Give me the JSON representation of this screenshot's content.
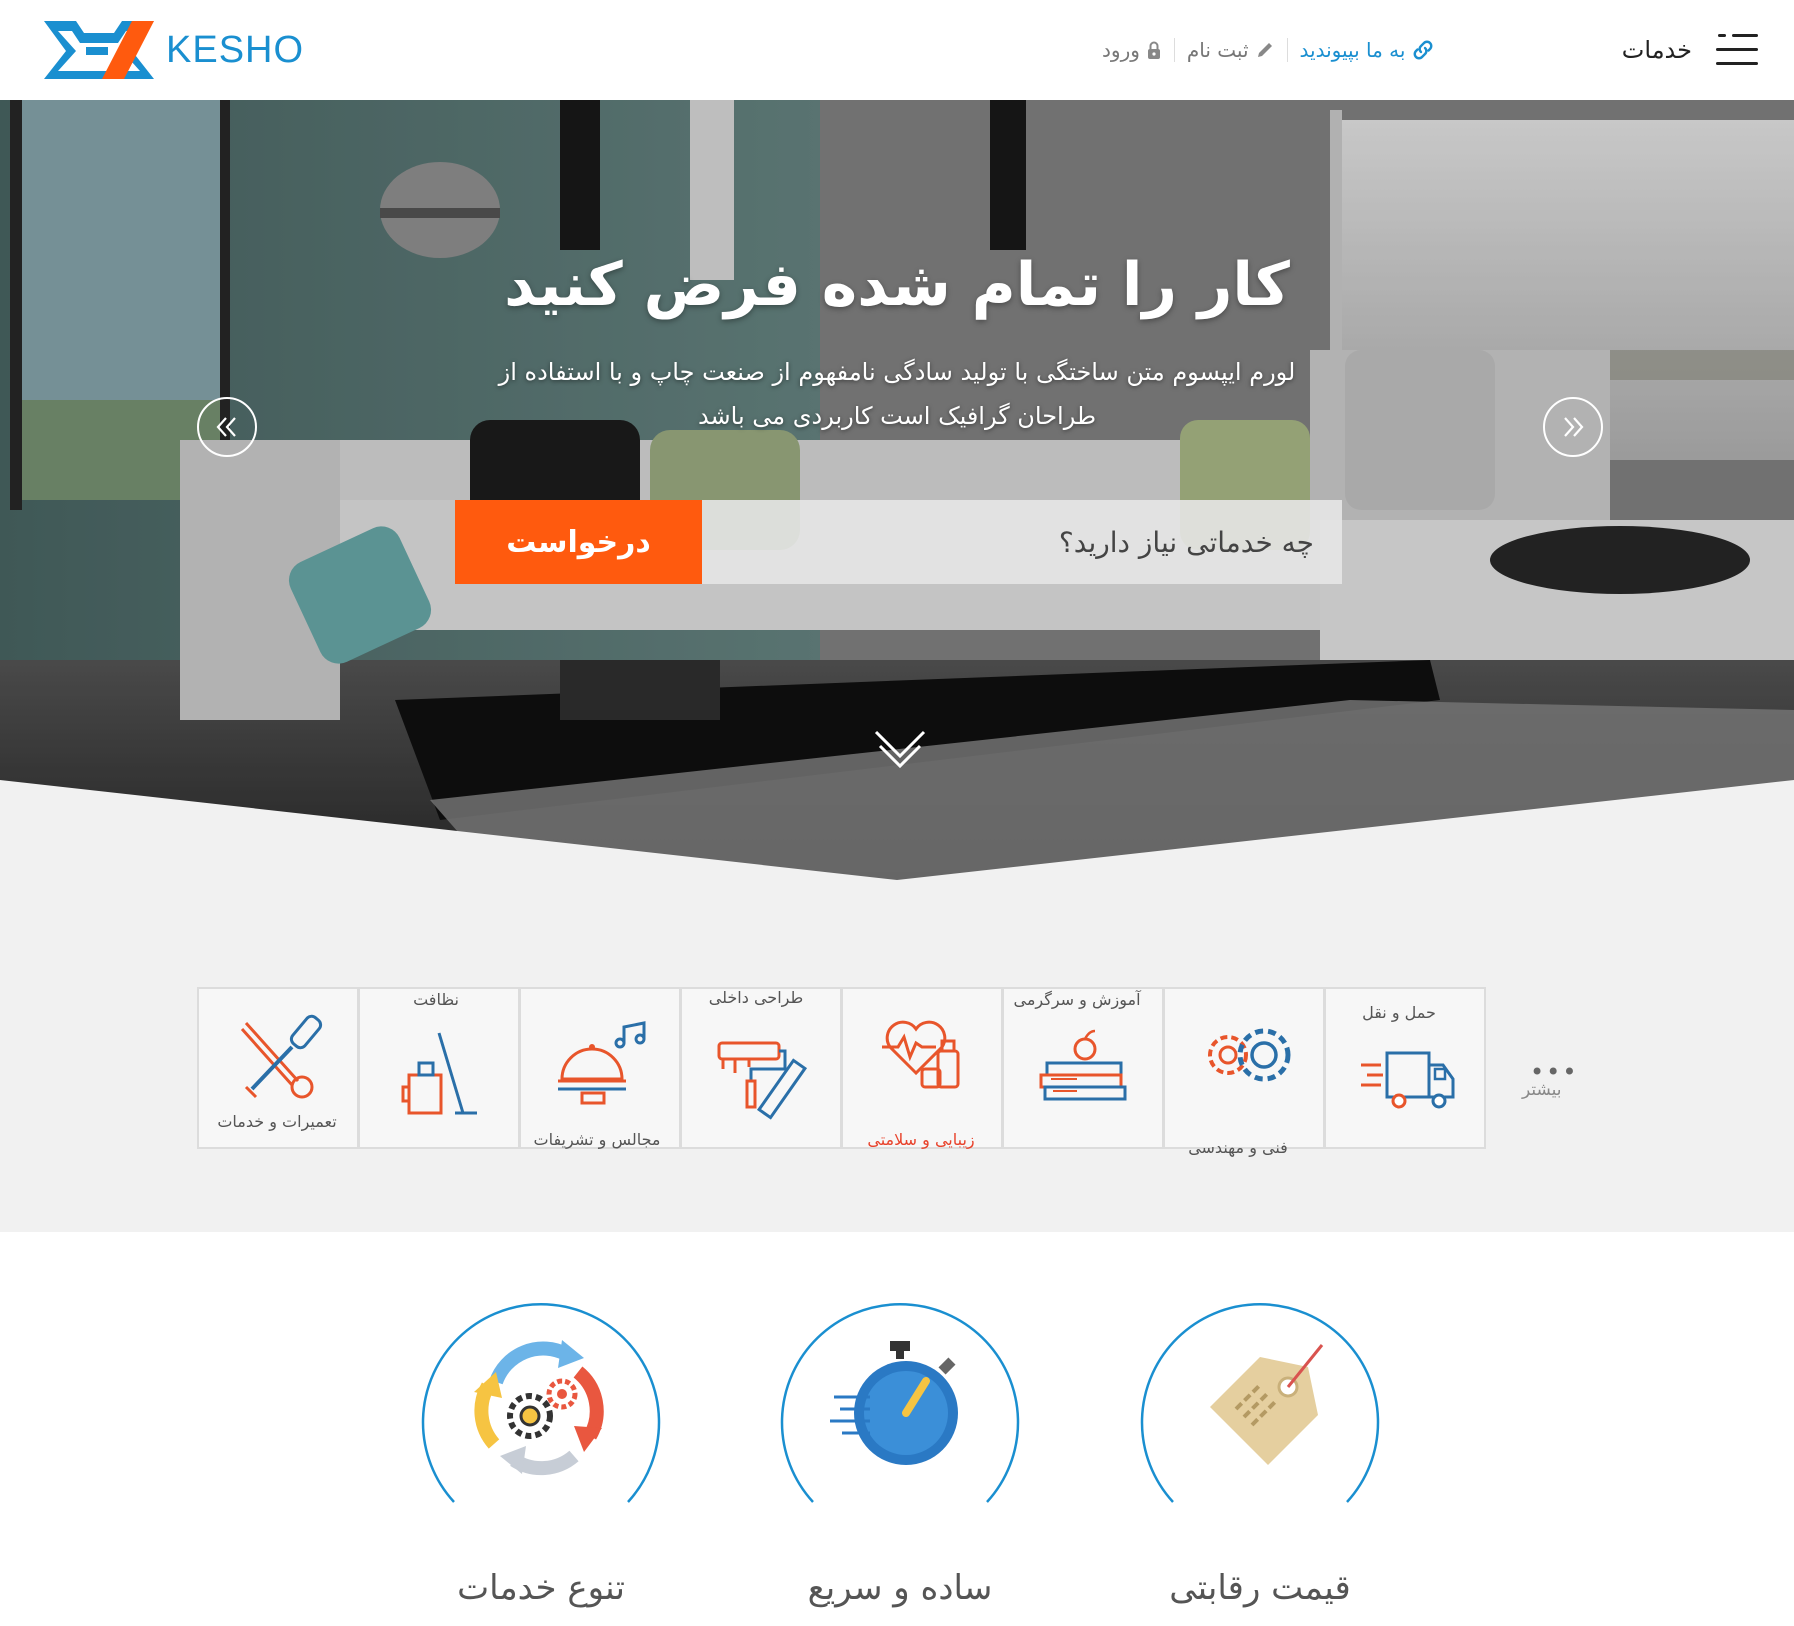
{
  "header": {
    "logo_text": "KESHO",
    "nav": {
      "join_label": "به ما بپیوندید",
      "signup_label": "ثبت نام",
      "login_label": "ورود"
    },
    "services_label": "خدمات"
  },
  "hero": {
    "title": "کار را تمام شده فرض کنید",
    "subtitle": "لورم ایپسوم متن ساختگی با تولید سادگی نامفهوم از صنعت چاپ و با استفاده از طراحان گرافیک است کاربردی می باشد",
    "search_placeholder": "چه خدماتی نیاز دارید؟",
    "request_label": "درخواست"
  },
  "categories": {
    "items": [
      {
        "label": "حمل و نقل",
        "icon": "truck-icon"
      },
      {
        "label": "فنی و مهندسی",
        "icon": "gears-icon"
      },
      {
        "label": "آموزش و سرگرمی",
        "icon": "books-icon"
      },
      {
        "label": "زیبایی و سلامتی",
        "icon": "heart-cosmetics-icon"
      },
      {
        "label": "طراحی داخلی",
        "icon": "paint-roller-icon"
      },
      {
        "label": "مجالس و تشریفات",
        "icon": "food-tray-icon"
      },
      {
        "label": "نظافت",
        "icon": "mop-bucket-icon"
      },
      {
        "label": "تعمیرات و خدمات",
        "icon": "wrench-screwdriver-icon"
      }
    ],
    "more_label": "بیشتر",
    "more_icon": "ellipsis-icon",
    "active_color": "#e8432c"
  },
  "features": [
    {
      "label": "قیمت رقابتی",
      "icon": "price-tag-icon"
    },
    {
      "label": "ساده و سریع",
      "icon": "stopwatch-icon"
    },
    {
      "label": "تنوع خدمات",
      "icon": "cycle-gears-icon"
    }
  ],
  "colors": {
    "brand_blue": "#1a8fd0",
    "accent_orange": "#ff5a0e",
    "icon_orange": "#e8552b",
    "icon_blue": "#2a6fa8"
  }
}
